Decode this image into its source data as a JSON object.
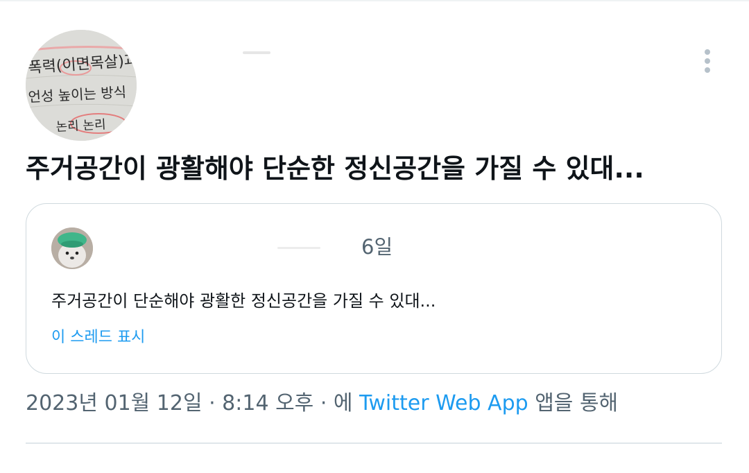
{
  "tweet": {
    "text": "주거공간이 광활해야 단순한 정신공간을 가질 수 있대...",
    "avatar_handwriting": [
      "폭력(이면목살)과",
      "언성 높이는 방식",
      "논리 논리"
    ]
  },
  "quote": {
    "time": "6일",
    "text": "주거공간이 단순해야 광활한 정신공간을 가질 수 있대...",
    "show_thread_label": "이 스레드 표시"
  },
  "meta": {
    "date_time": "2023년 01월 12일 · 8:14 오후 · 에 ",
    "source_label": "Twitter Web App",
    "suffix": " 앱을 통해"
  },
  "colors": {
    "text": "#0f1419",
    "secondary": "#536471",
    "link": "#1d9bf0",
    "border": "#cfd9de"
  },
  "icons": {
    "more": "more-vertical-icon"
  }
}
